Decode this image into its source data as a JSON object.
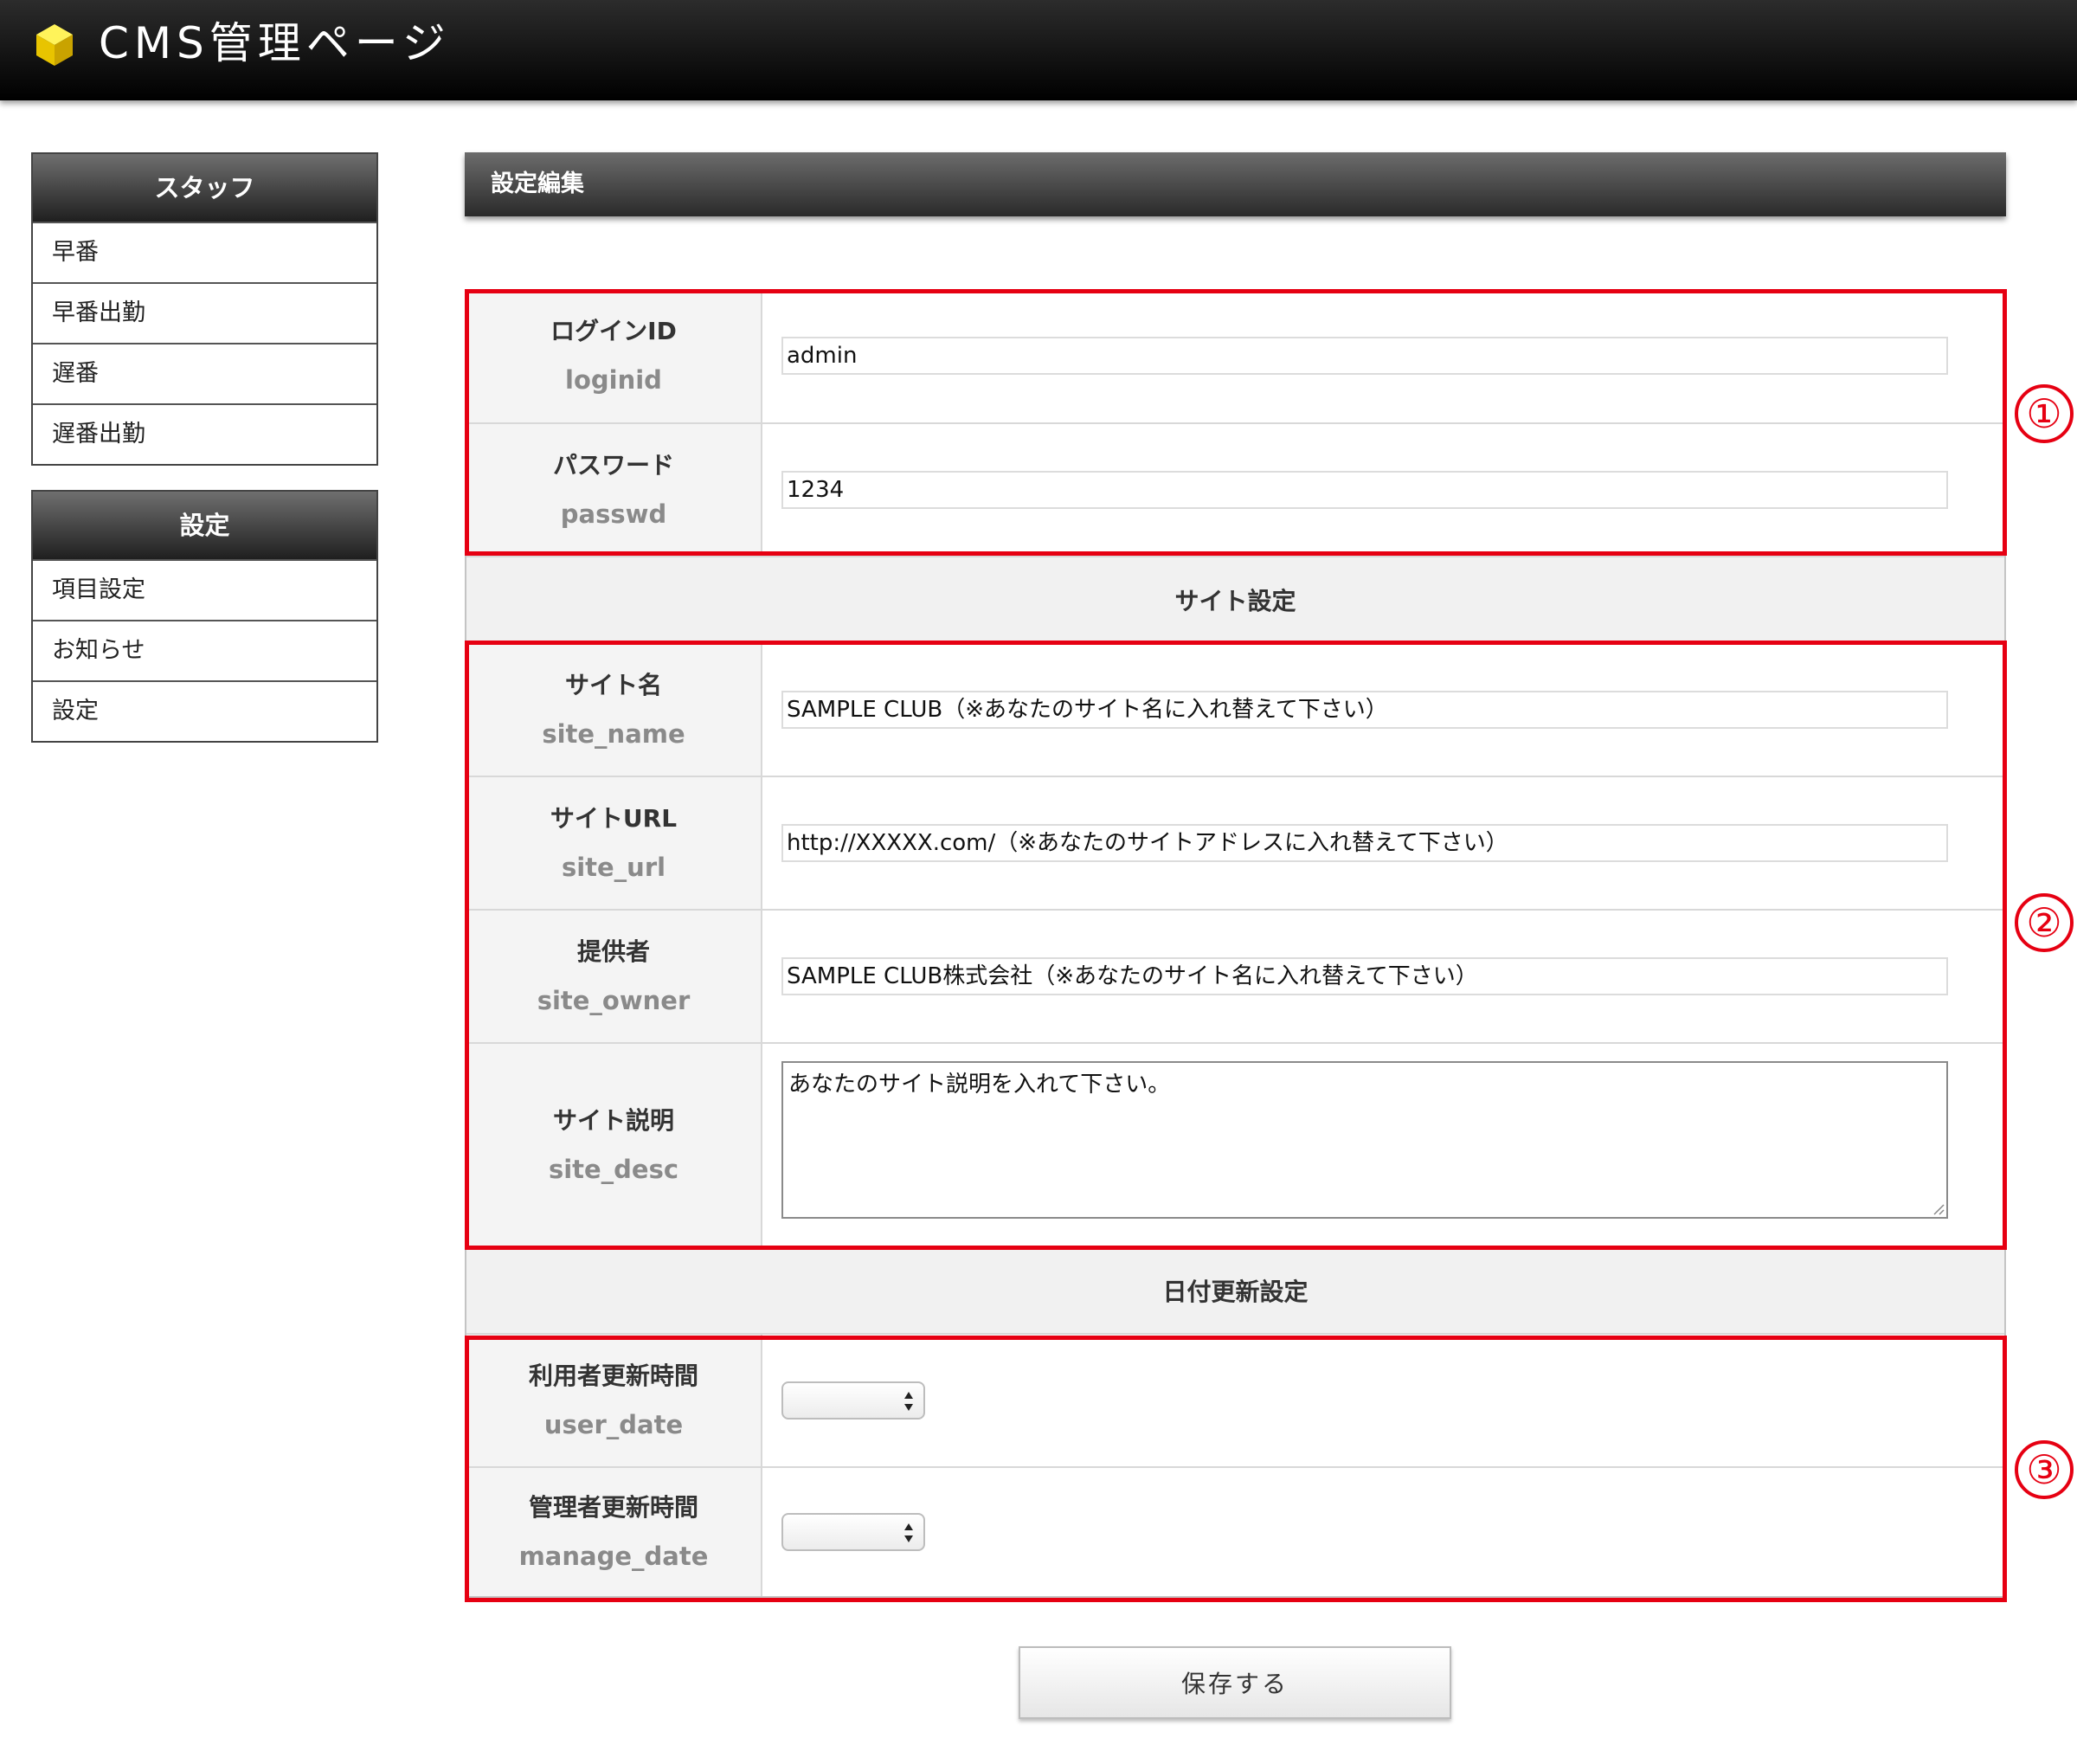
{
  "header": {
    "title": "CMS管理ページ",
    "logo_icon": "yellow-cube-icon"
  },
  "sidebar": {
    "staff": {
      "title": "スタッフ",
      "items": [
        "早番",
        "早番出勤",
        "遅番",
        "遅番出勤"
      ]
    },
    "settings": {
      "title": "設定",
      "items": [
        "項目設定",
        "お知らせ",
        "設定"
      ]
    }
  },
  "main": {
    "section_title": "設定編集",
    "fields": {
      "loginid": {
        "label": "ログインID",
        "key": "loginid",
        "value": "admin"
      },
      "passwd": {
        "label": "パスワード",
        "key": "passwd",
        "value": "1234"
      },
      "site_name": {
        "label": "サイト名",
        "key": "site_name",
        "value": "SAMPLE CLUB（※あなたのサイト名に入れ替えて下さい）"
      },
      "site_url": {
        "label": "サイトURL",
        "key": "site_url",
        "value": "http://XXXXX.com/（※あなたのサイトアドレスに入れ替えて下さい）"
      },
      "site_owner": {
        "label": "提供者",
        "key": "site_owner",
        "value": "SAMPLE CLUB株式会社（※あなたのサイト名に入れ替えて下さい）"
      },
      "site_desc": {
        "label": "サイト説明",
        "key": "site_desc",
        "value": "あなたのサイト説明を入れて下さい。"
      },
      "user_date": {
        "label": "利用者更新時間",
        "key": "user_date",
        "value": ""
      },
      "manage_date": {
        "label": "管理者更新時間",
        "key": "manage_date",
        "value": ""
      }
    },
    "groups": {
      "site": "サイト設定",
      "date": "日付更新設定"
    },
    "save_label": "保存する"
  },
  "annotations": [
    "①",
    "②",
    "③"
  ],
  "colors": {
    "annotation_red": "#e60012",
    "header_black": "#000000",
    "logo_yellow": "#f2d600"
  }
}
